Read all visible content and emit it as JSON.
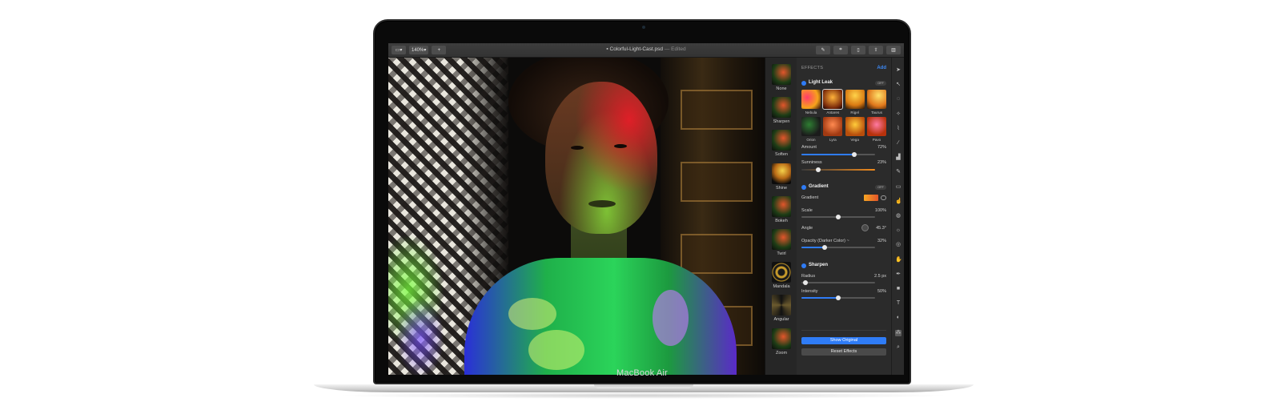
{
  "device": {
    "label": "MacBook Air"
  },
  "toolbar": {
    "view_btn": "▭▾",
    "zoom": "140%▾",
    "add_btn": "+",
    "filename": "Colorful-Light-Cast.psd",
    "edited": "— Edited",
    "right_icons": [
      "pen-icon",
      "crop-icon",
      "document-icon",
      "share-icon",
      "sidebar-icon"
    ]
  },
  "thumbnails": [
    {
      "label": "None",
      "style": ""
    },
    {
      "label": "Sharpen",
      "style": ""
    },
    {
      "label": "Soften",
      "style": ""
    },
    {
      "label": "Shine",
      "style": "shine"
    },
    {
      "label": "Bokeh",
      "style": ""
    },
    {
      "label": "Twirl",
      "style": ""
    },
    {
      "label": "Mandala",
      "style": "mandala"
    },
    {
      "label": "Angular",
      "style": "angular"
    },
    {
      "label": "Zoom",
      "style": ""
    }
  ],
  "panel": {
    "header": "EFFECTS",
    "add": "Add",
    "light_leak": {
      "name": "Light Leak",
      "chip": "OFF",
      "presets_row1": [
        "Nebula",
        "Antares",
        "Rigel",
        "Taurus"
      ],
      "presets_row2": [
        "Orion",
        "Lyra",
        "Vega",
        "Pavo"
      ],
      "amount_label": "Amount",
      "amount_value": "72%",
      "amount": 0.72,
      "sunniness_label": "Sunniness",
      "sunniness_value": "23%",
      "sunniness": 0.23
    },
    "gradient": {
      "name": "Gradient",
      "chip": "OFF",
      "gradient_label": "Gradient",
      "scale_label": "Scale",
      "scale_value": "100%",
      "scale": 0.5,
      "angle_label": "Angle",
      "angle_value": "45.3°",
      "opacity_label": "Opacity (Darker Color) ~",
      "opacity_value": "32%",
      "opacity": 0.32
    },
    "sharpen": {
      "name": "Sharpen",
      "radius_label": "Radius",
      "radius_value": "2.5 px",
      "radius": 0.05,
      "intensity_label": "Intensity",
      "intensity_value": "50%",
      "intensity": 0.5
    },
    "show_original": "Show Original",
    "reset_effects": "Reset Effects"
  },
  "tools": [
    "select-arrow-icon",
    "pointer-icon",
    "lasso-icon",
    "magic-wand-icon",
    "eyedropper-icon",
    "brush-icon",
    "bucket-icon",
    "pen-icon",
    "eraser-icon",
    "smudge-icon",
    "blur-icon",
    "sun-icon",
    "sponge-icon",
    "hand-icon",
    "vector-pen-icon",
    "shape-icon",
    "text-icon",
    "fill-icon",
    "effects-icon",
    "zoom-icon"
  ]
}
